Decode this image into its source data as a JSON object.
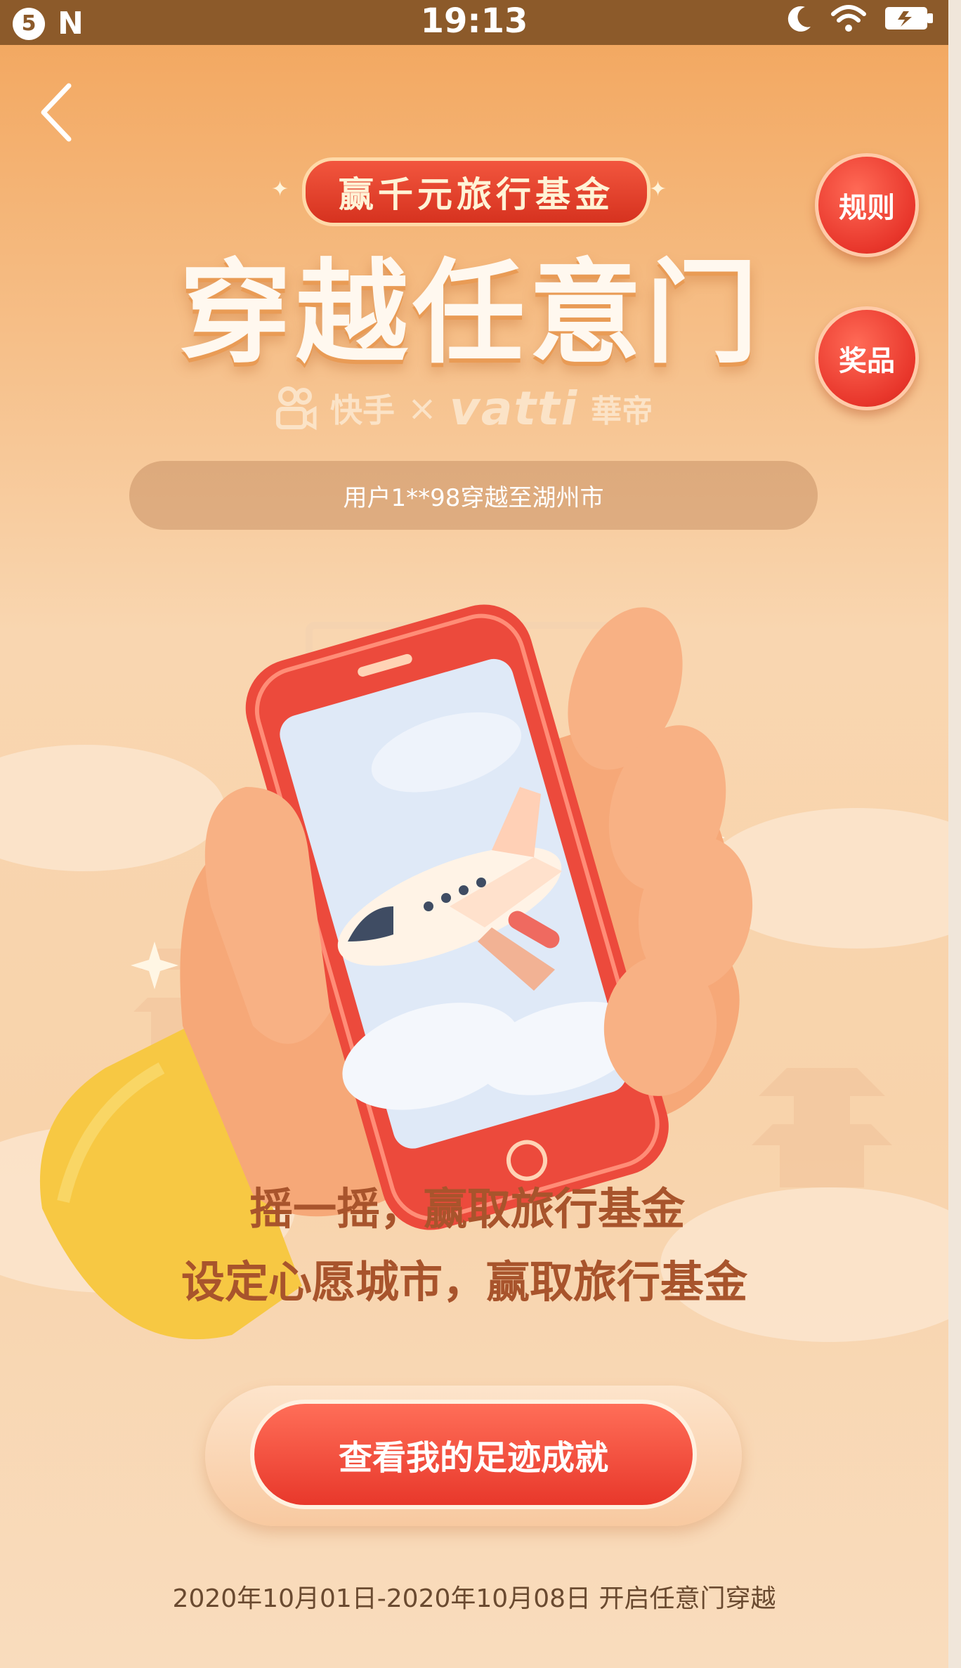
{
  "status_bar": {
    "notification_count": "5",
    "time": "19:13",
    "icons": [
      "notification-icon",
      "n-icon",
      "moon-icon",
      "wifi-icon",
      "battery-icon"
    ]
  },
  "nav": {
    "back_icon": "back-icon",
    "rules_label": "规则",
    "prizes_label": "奖品"
  },
  "hero": {
    "badge": "赢千元旅行基金",
    "title": "穿越任意门",
    "brand_kuaishou": "快手",
    "brand_separator": "×",
    "brand_vatti": "vatti",
    "brand_huadi": "華帝"
  },
  "ticker": {
    "text": "用户1**98穿越至湖州市"
  },
  "headlines": {
    "line1": "摇一摇，赢取旅行基金",
    "line2": "设定心愿城市，赢取旅行基金"
  },
  "cta": {
    "label": "查看我的足迹成就"
  },
  "footer": {
    "date_text": "2020年10月01日-2020年10月08日 开启任意门穿越"
  },
  "colors": {
    "status_bar": "#8c5a2a",
    "accent_red": "#e8382b",
    "headline": "#a8542c",
    "background_top": "#f2a55c",
    "background_bottom": "#f9dcbd"
  }
}
